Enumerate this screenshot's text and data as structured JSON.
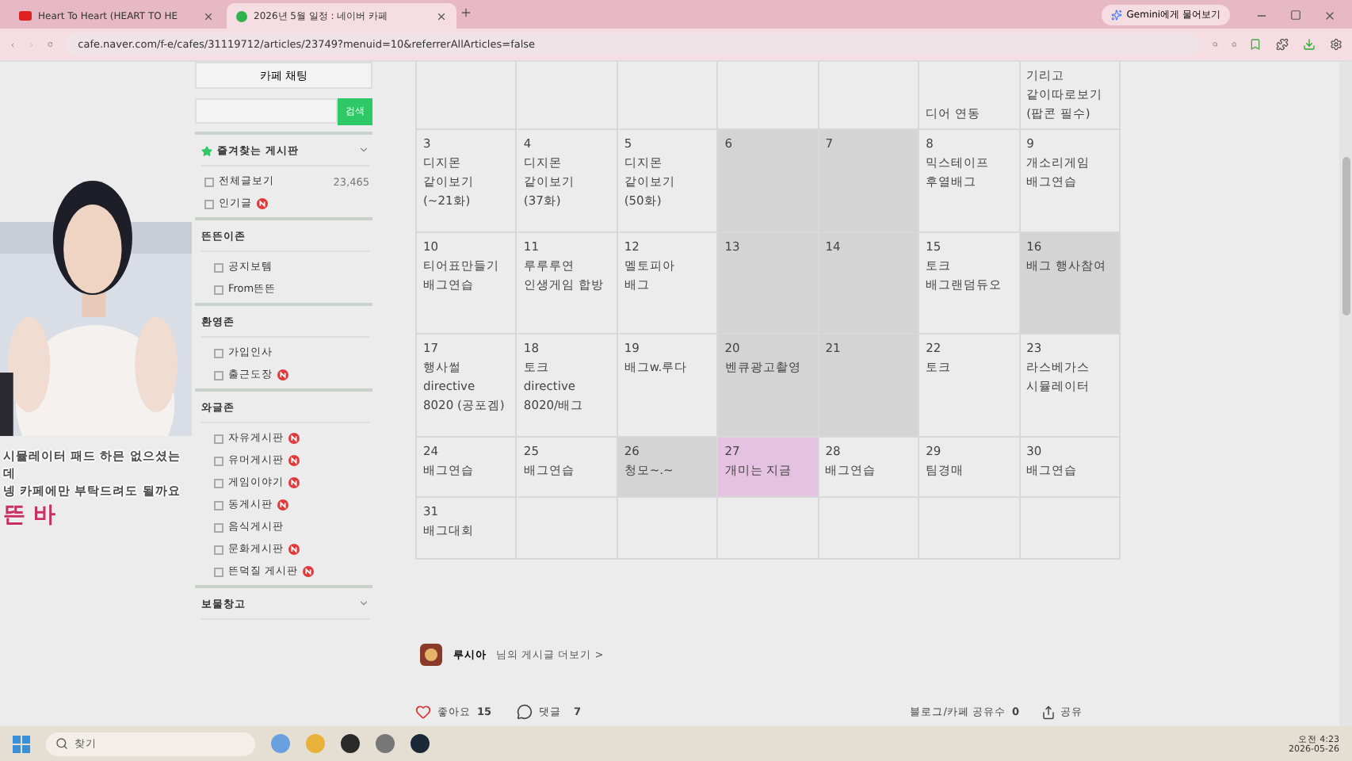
{
  "browser": {
    "tabs": [
      {
        "title": "Heart To Heart (HEART TO HE",
        "kind": "video",
        "selected": false
      },
      {
        "title": "2026년 5월 일정 : 네이버 카페",
        "kind": "cafe",
        "selected": true
      }
    ],
    "gemini_button": "Gemini에게 물어보기",
    "url": "cafe.naver.com/f-e/cafes/31119712/articles/23749?menuid=10&referrerAllArticles=false"
  },
  "sidebar": {
    "chat_button": "카페 채팅",
    "search_button": "검색",
    "favorites": {
      "title": "즐겨찾는 게시판",
      "items": [
        {
          "label": "전체글보기",
          "count": "23,465",
          "new": false
        },
        {
          "label": "인기글",
          "new": true
        }
      ]
    },
    "sections": [
      {
        "title": "뜬뜬이존",
        "items": [
          {
            "label": "공지보템",
            "new": false
          },
          {
            "label": "From뜬뜬",
            "new": false
          }
        ]
      },
      {
        "title": "환영존",
        "items": [
          {
            "label": "가입인사",
            "new": false
          },
          {
            "label": "출근도장",
            "new": true
          }
        ]
      },
      {
        "title": "와글존",
        "items": [
          {
            "label": "자유게시판",
            "new": true
          },
          {
            "label": "유머게시판",
            "new": true
          },
          {
            "label": "게임이야기",
            "new": true
          },
          {
            "label": "동게시판",
            "new": true
          },
          {
            "label": "음식게시판",
            "new": false
          },
          {
            "label": "문화게시판",
            "new": true
          },
          {
            "label": "뜬덕질 게시판",
            "new": true
          }
        ]
      }
    ],
    "bottom_section": "보물창고"
  },
  "calendar": {
    "rows": [
      [
        {
          "color": "#ececec"
        },
        {
          "color": "#ececec"
        },
        {
          "color": "#ececec"
        },
        {
          "color": "#ececec"
        },
        {
          "color": "#ececec"
        },
        {
          "lines": [
            "디어 연동"
          ],
          "color": "#ececec"
        },
        {
          "lines": [
            "기리고",
            "같이따로보기",
            "(팝콘 필수)"
          ],
          "color": "#ececec"
        }
      ],
      [
        {
          "day": "3",
          "lines": [
            "디지몬",
            "같이보기",
            "(~21화)"
          ],
          "color": "#ececec"
        },
        {
          "day": "4",
          "lines": [
            "디지몬",
            "같이보기",
            "(37화)"
          ],
          "color": "#ececec"
        },
        {
          "day": "5",
          "lines": [
            "디지몬",
            "같이보기",
            "(50화)"
          ],
          "color": "#ececec"
        },
        {
          "day": "6",
          "color": "#d4d4d4"
        },
        {
          "day": "7",
          "color": "#d4d4d4"
        },
        {
          "day": "8",
          "lines": [
            "믹스테이프",
            "후열배그"
          ],
          "color": "#ececec"
        },
        {
          "day": "9",
          "lines": [
            "개소리게임",
            "배그연습"
          ],
          "color": "#ececec"
        }
      ],
      [
        {
          "day": "10",
          "lines": [
            "티어표만들기",
            "배그연습"
          ],
          "color": "#ececec"
        },
        {
          "day": "11",
          "lines": [
            "루루루연",
            "인생게임 합방"
          ],
          "color": "#ececec"
        },
        {
          "day": "12",
          "lines": [
            "멜토피아",
            "배그"
          ],
          "color": "#ececec"
        },
        {
          "day": "13",
          "color": "#d4d4d4"
        },
        {
          "day": "14",
          "color": "#d4d4d4"
        },
        {
          "day": "15",
          "lines": [
            "토크",
            "배그랜덤듀오"
          ],
          "color": "#ececec"
        },
        {
          "day": "16",
          "lines": [
            "배그 행사참여"
          ],
          "color": "#d4d4d4"
        }
      ],
      [
        {
          "day": "17",
          "lines": [
            "행사썰",
            "directive",
            "8020 (공포겜)"
          ],
          "color": "#ececec"
        },
        {
          "day": "18",
          "lines": [
            "토크",
            "directive",
            "8020/배그"
          ],
          "color": "#ececec"
        },
        {
          "day": "19",
          "lines": [
            "배그w.루다"
          ],
          "color": "#ececec"
        },
        {
          "day": "20",
          "lines": [
            "벤큐광고촬영"
          ],
          "color": "#d4d4d4"
        },
        {
          "day": "21",
          "color": "#d4d4d4"
        },
        {
          "day": "22",
          "lines": [
            "토크"
          ],
          "color": "#ececec"
        },
        {
          "day": "23",
          "lines": [
            "라스베가스",
            "시뮬레이터"
          ],
          "color": "#ececec"
        }
      ],
      [
        {
          "day": "24",
          "lines": [
            "배그연습"
          ],
          "color": "#ececec"
        },
        {
          "day": "25",
          "lines": [
            "배그연습"
          ],
          "color": "#ececec"
        },
        {
          "day": "26",
          "lines": [
            "청모~.~"
          ],
          "color": "#d4d4d4"
        },
        {
          "day": "27",
          "lines": [
            "개미는 지금"
          ],
          "color": "#e6c2e2"
        },
        {
          "day": "28",
          "lines": [
            "배그연습"
          ],
          "color": "#ececec"
        },
        {
          "day": "29",
          "lines": [
            "팀경매"
          ],
          "color": "#ececec"
        },
        {
          "day": "30",
          "lines": [
            "배그연습"
          ],
          "color": "#ececec"
        }
      ],
      [
        {
          "day": "31",
          "lines": [
            "배그대회"
          ],
          "color": "#ececec"
        },
        {
          "color": "#ececec"
        },
        {
          "color": "#ececec"
        },
        {
          "color": "#ececec"
        },
        {
          "color": "#ececec"
        },
        {
          "color": "#ececec"
        },
        {
          "color": "#ececec"
        }
      ]
    ]
  },
  "post_footer": {
    "author": "루시아",
    "more_link": "님의 게시글 더보기 >",
    "like_label": "좋아요",
    "like_count": "15",
    "comment_label": "댓글",
    "comment_count": "7",
    "share_count_label": "블로그/카페 공유수",
    "share_count": "0",
    "share_button": "공유"
  },
  "subtitles": [
    {
      "text": "시뮬레이터 패드 하믄 없으셨는",
      "kind": "caption"
    },
    {
      "text": "데",
      "kind": "caption"
    },
    {
      "text": "넹 카페에만 부탁드려도 될까요",
      "kind": "caption"
    },
    {
      "text": "뜬 바",
      "kind": "highlight"
    }
  ],
  "taskbar": {
    "search_placeholder": "찾기",
    "time": "오전 4:23",
    "date": "2026-05-26"
  }
}
